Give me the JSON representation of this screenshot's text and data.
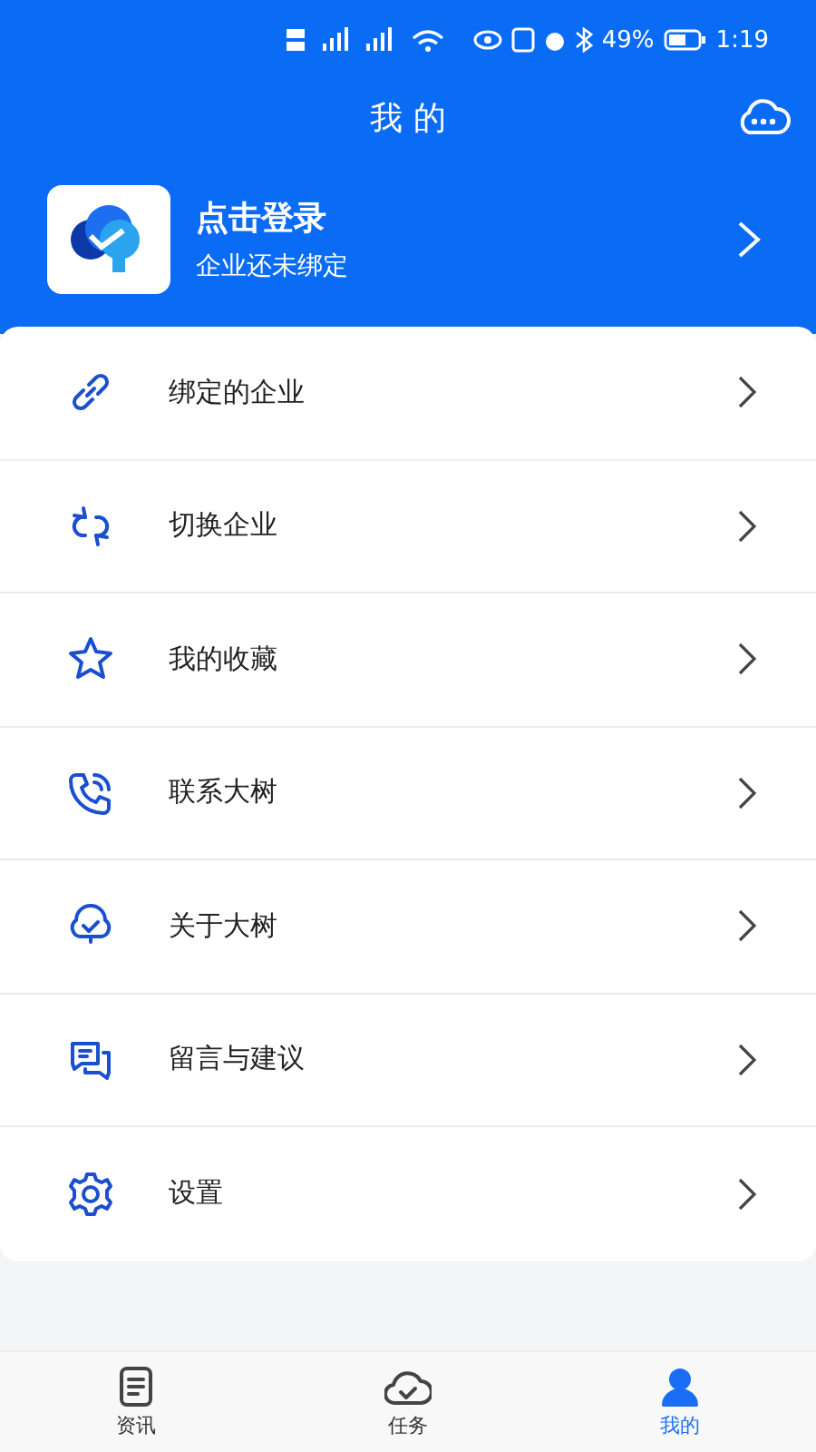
{
  "status_bar": {
    "battery": "49%",
    "time": "1:19"
  },
  "header": {
    "title": "我 的"
  },
  "profile": {
    "name": "点击登录",
    "subtitle": "企业还未绑定"
  },
  "menu": [
    {
      "kind": "link",
      "label": "绑定的企业"
    },
    {
      "kind": "switch",
      "label": "切换企业"
    },
    {
      "kind": "star",
      "label": "我的收藏"
    },
    {
      "kind": "phone",
      "label": "联系大树"
    },
    {
      "kind": "tree",
      "label": "关于大树"
    },
    {
      "kind": "message",
      "label": "留言与建议"
    },
    {
      "kind": "gear",
      "label": "设置"
    }
  ],
  "tabs": [
    {
      "kind": "news",
      "label": "资讯",
      "selected": false
    },
    {
      "kind": "task",
      "label": "任务",
      "selected": false
    },
    {
      "kind": "me",
      "label": "我的",
      "selected": true
    }
  ]
}
